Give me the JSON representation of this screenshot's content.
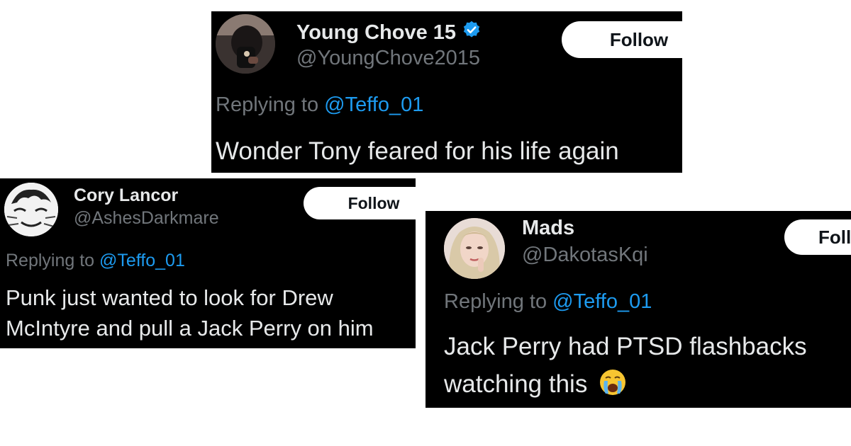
{
  "tweets": [
    {
      "name": "Young Chove 15",
      "verified": true,
      "handle": "@YoungChove2015",
      "follow_label": "Follow",
      "reply_prefix": "Replying to",
      "reply_mention": "@Teffo_01",
      "text": "Wonder Tony feared for his life again"
    },
    {
      "name": "Cory Lancor",
      "verified": false,
      "handle": "@AshesDarkmare",
      "follow_label": "Follow",
      "reply_prefix": "Replying to",
      "reply_mention": "@Teffo_01",
      "text_line1": "Punk just wanted to look for Drew",
      "text_line2": "McIntyre and pull a Jack Perry on him"
    },
    {
      "name": "Mads",
      "verified": false,
      "handle": "@DakotasKqi",
      "follow_label": "Follow",
      "reply_prefix": "Replying to",
      "reply_mention": "@Teffo_01",
      "text_line1": "Jack Perry had PTSD flashbacks",
      "text_line2": "watching this",
      "emoji": "😭"
    }
  ],
  "colors": {
    "background": "#ffffff",
    "card": "#000000",
    "text": "#e7e9ea",
    "muted": "#71767b",
    "link": "#1d9bf0",
    "follow_bg": "#ffffff"
  }
}
